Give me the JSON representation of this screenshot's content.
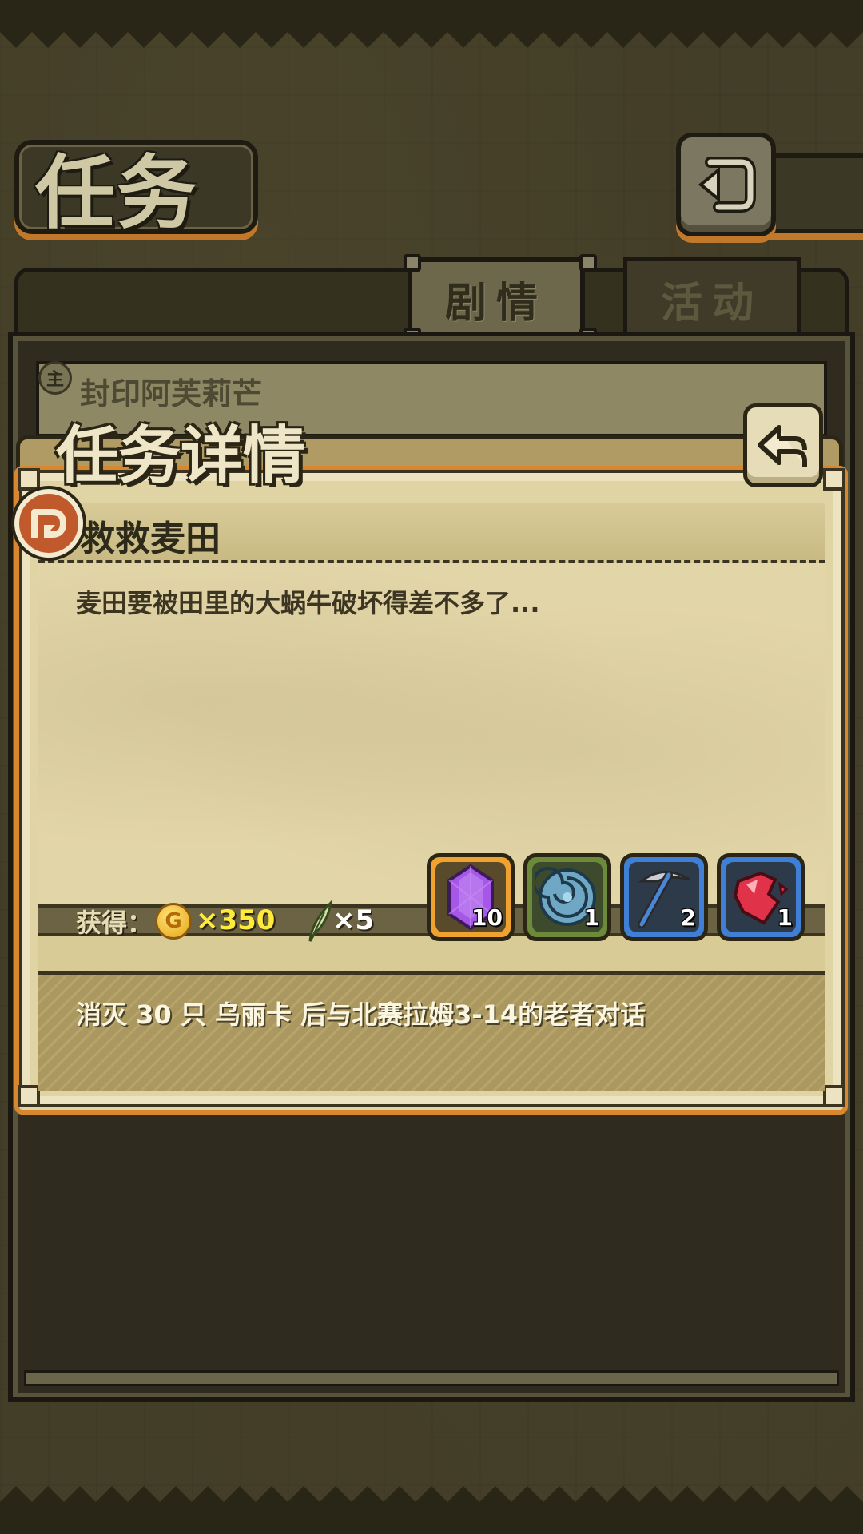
{
  "header": {
    "title": "任务"
  },
  "tabs": [
    {
      "label": "剧情",
      "active": true
    },
    {
      "label": "活动",
      "active": false
    }
  ],
  "quest_list": [
    {
      "label": "封印阿芙莉芒",
      "icon": "main-quest-icon",
      "icon_text": "主"
    }
  ],
  "detail": {
    "title": "任务详情",
    "quest_name": "救救麦田",
    "description": "麦田要被田里的大蜗牛破坏得差不多了...",
    "reward_label": "获得：",
    "coin_icon_text": "G",
    "coin_amount": "×350",
    "feather_amount": "×5",
    "items": [
      {
        "icon": "purple-crystal-icon",
        "count": "10",
        "frame_color": "#f0a22e"
      },
      {
        "icon": "blue-shell-icon",
        "count": "1",
        "frame_color": "#6d8a3a"
      },
      {
        "icon": "pickaxe-icon",
        "count": "2",
        "frame_color": "#3f7fd6"
      },
      {
        "icon": "red-ruby-fragment-icon",
        "count": "1",
        "frame_color": "#3f7fd6"
      }
    ],
    "objective": "消灭 30 只 乌丽卡 后与北赛拉姆3-14的老者对话"
  },
  "colors": {
    "accent_orange": "#d8872e",
    "coin_text": "#ffec3a",
    "parchment": "#e0d3a4"
  }
}
